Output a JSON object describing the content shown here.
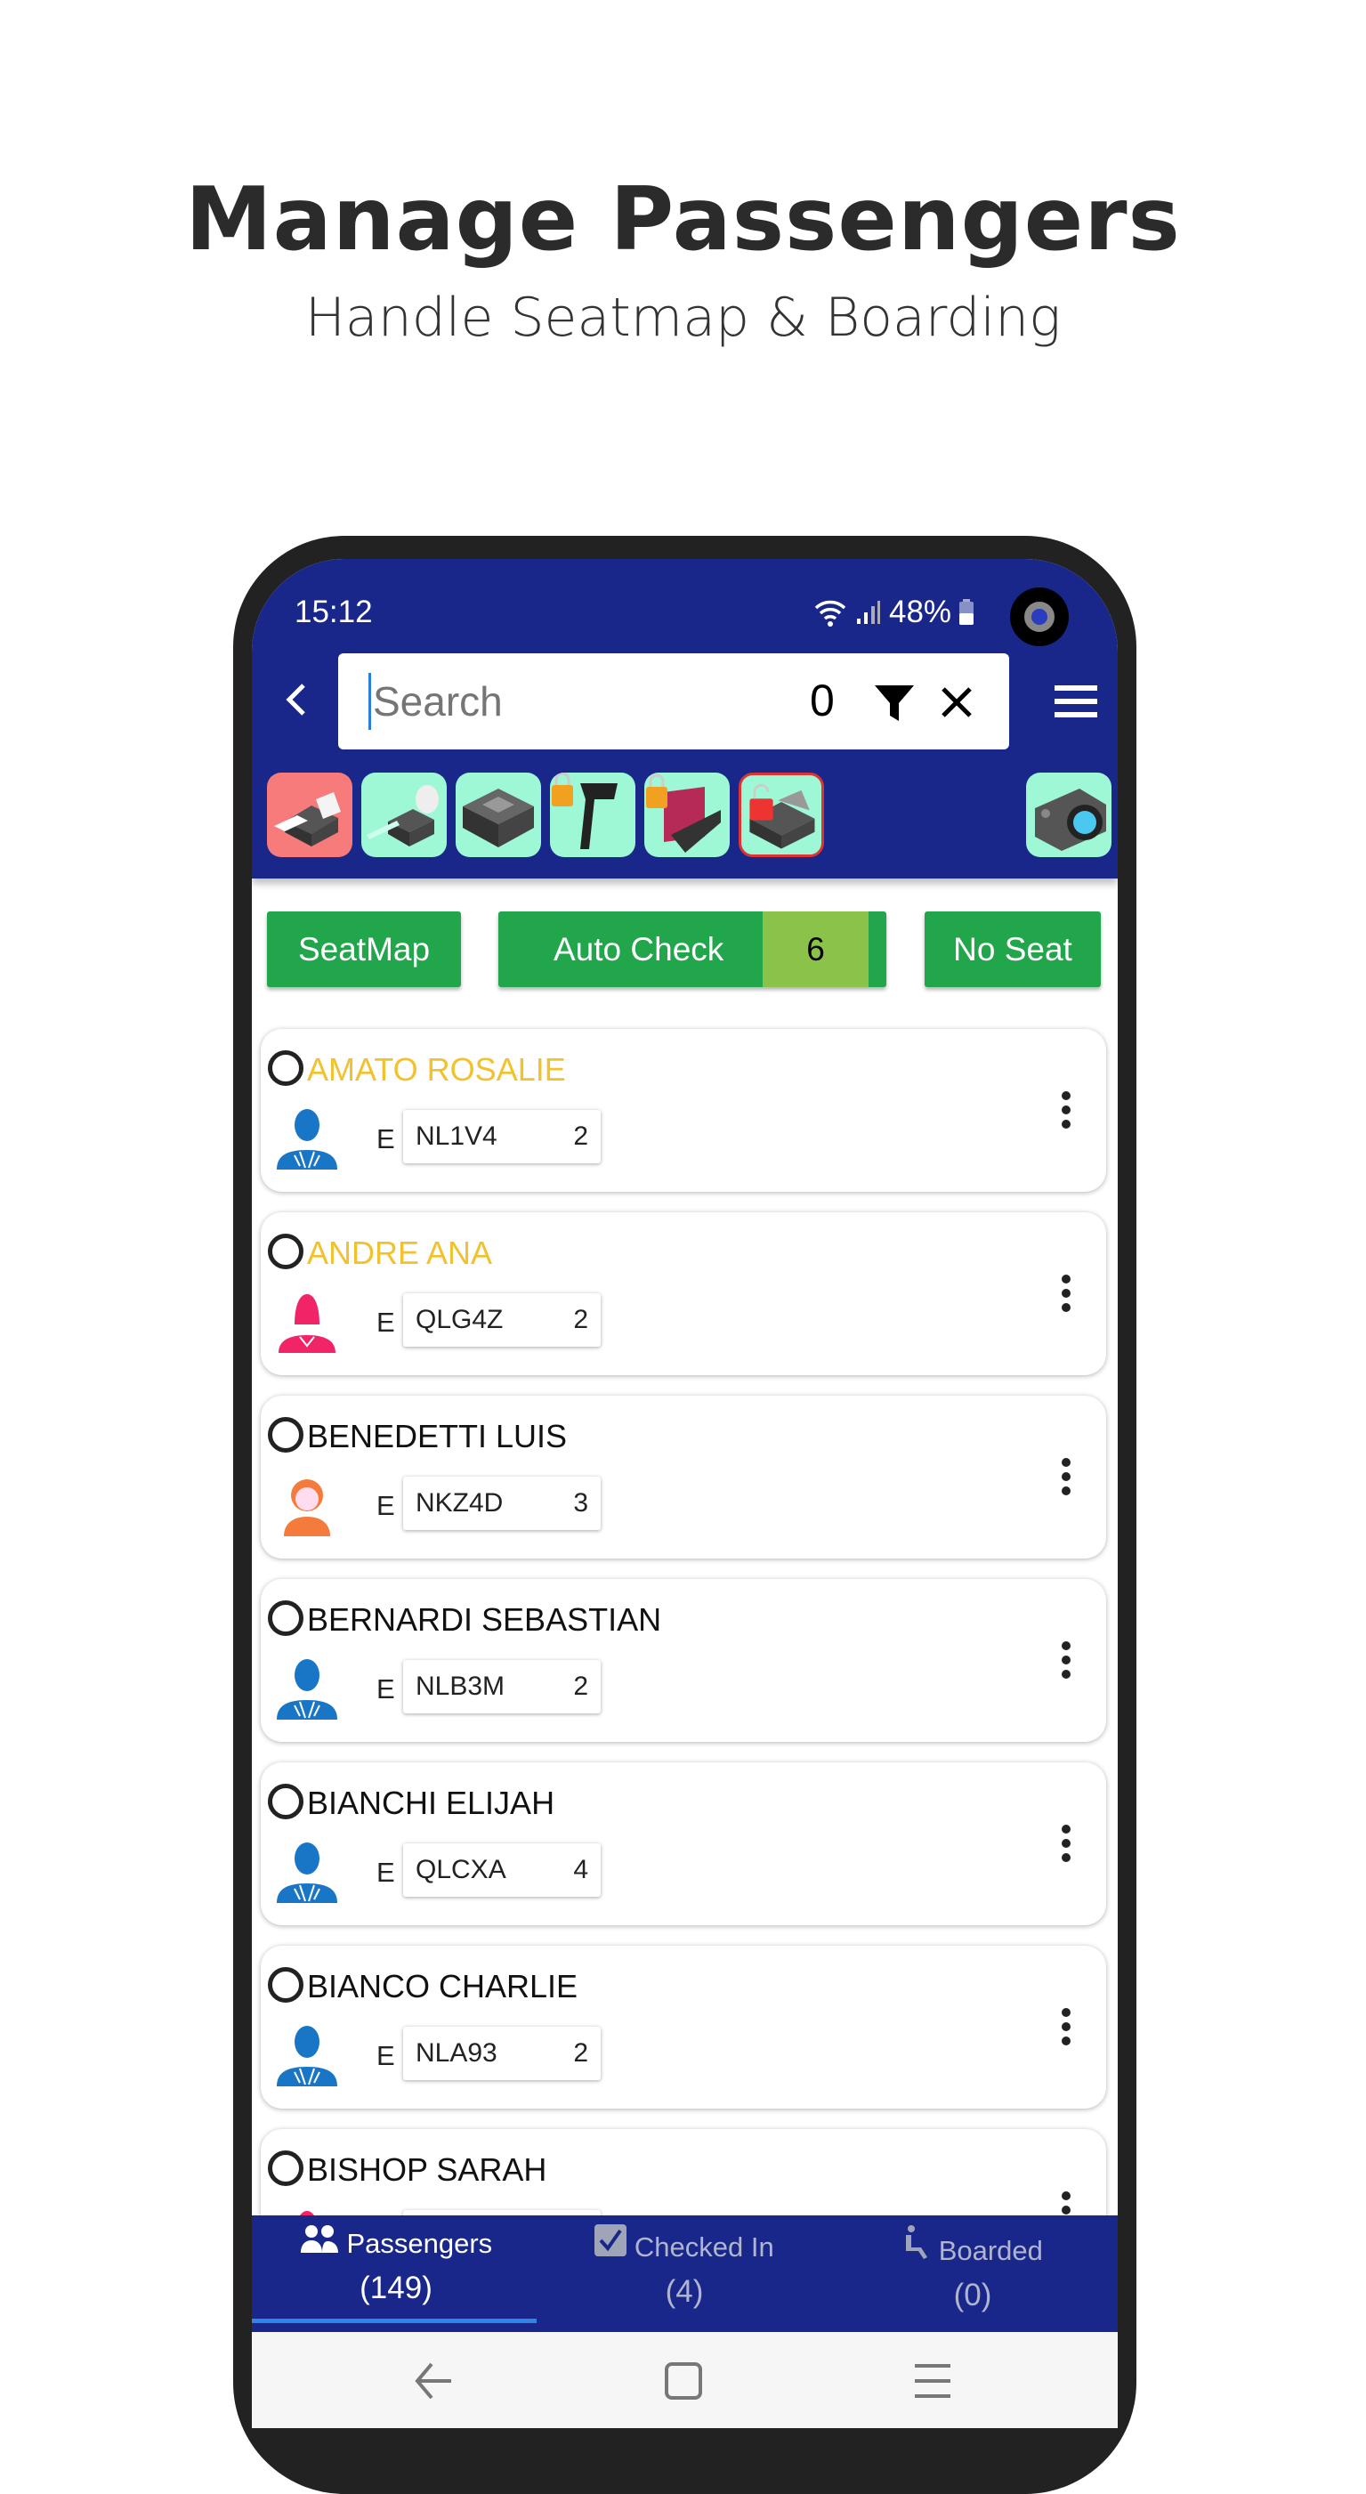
{
  "promo": {
    "title": "Manage Passengers",
    "subtitle": "Handle Seatmap & Boarding"
  },
  "status_bar": {
    "time": "15:12",
    "battery": "48%"
  },
  "search": {
    "placeholder": "Search",
    "count": "0"
  },
  "toolbar": {
    "tools": [
      "boarding-pass-printer",
      "bag-tag-printer",
      "document-printer",
      "barcode-scanner-locked",
      "passport-reader-locked",
      "printer-unlocked"
    ],
    "camera": "camera"
  },
  "actions": {
    "seatmap": "SeatMap",
    "auto_check": "Auto Check",
    "auto_check_count": "6",
    "no_seat": "No Seat"
  },
  "passengers": [
    {
      "name": "AMATO ROSALIE",
      "name_color": "#f2c12e",
      "avatar": "male",
      "class": "E",
      "pnr": "NL1V4",
      "count": "2"
    },
    {
      "name": "ANDRE ANA",
      "name_color": "#f2c12e",
      "avatar": "female",
      "class": "E",
      "pnr": "QLG4Z",
      "count": "2"
    },
    {
      "name": "BENEDETTI LUIS",
      "name_color": "#111111",
      "avatar": "child",
      "class": "E",
      "pnr": "NKZ4D",
      "count": "3"
    },
    {
      "name": "BERNARDI SEBASTIAN",
      "name_color": "#111111",
      "avatar": "male",
      "class": "E",
      "pnr": "NLB3M",
      "count": "2"
    },
    {
      "name": "BIANCHI ELIJAH",
      "name_color": "#111111",
      "avatar": "male",
      "class": "E",
      "pnr": "QLCXA",
      "count": "4"
    },
    {
      "name": "BIANCO CHARLIE",
      "name_color": "#111111",
      "avatar": "male",
      "class": "E",
      "pnr": "NLA93",
      "count": "2"
    },
    {
      "name": "BISHOP SARAH",
      "name_color": "#111111",
      "avatar": "female",
      "class": "",
      "pnr": "",
      "count": ""
    }
  ],
  "bottom_tabs": [
    {
      "label": "Passengers",
      "count": "(149)",
      "icon": "people",
      "active": true
    },
    {
      "label": "Checked In",
      "count": "(4)",
      "icon": "checkbox",
      "active": false
    },
    {
      "label": "Boarded",
      "count": "(0)",
      "icon": "seated-person",
      "active": false
    }
  ],
  "colors": {
    "header": "#1a278a",
    "button": "#22a64b",
    "badge": "#8bc34a",
    "male": "#1976c6",
    "female": "#f22468",
    "child": "#f47b3c",
    "tool_bg": "#9ef7d5",
    "tool_active_bg": "#f77b7b"
  }
}
